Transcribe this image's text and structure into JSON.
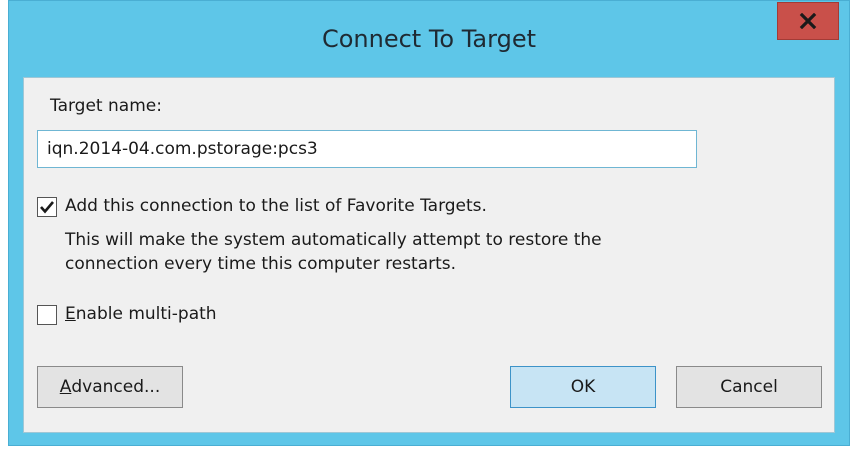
{
  "window": {
    "title": "Connect To Target",
    "close_icon": "close-icon"
  },
  "form": {
    "target_label": "Target name:",
    "target_value": "iqn.2014-04.com.pstorage:pcs3",
    "favorite": {
      "checked": true,
      "label": "Add this connection to the list of Favorite Targets.",
      "description_line1": "This will make the system automatically attempt to restore the",
      "description_line2": "connection every time this computer restarts."
    },
    "multipath": {
      "checked": false,
      "label_first": "E",
      "label_rest": "nable multi-path"
    }
  },
  "buttons": {
    "advanced_first": "A",
    "advanced_rest": "dvanced...",
    "ok": "OK",
    "cancel": "Cancel"
  },
  "colors": {
    "frame": "#5ec6e8",
    "close": "#c9504a",
    "ok_highlight": "#c7e4f4"
  }
}
